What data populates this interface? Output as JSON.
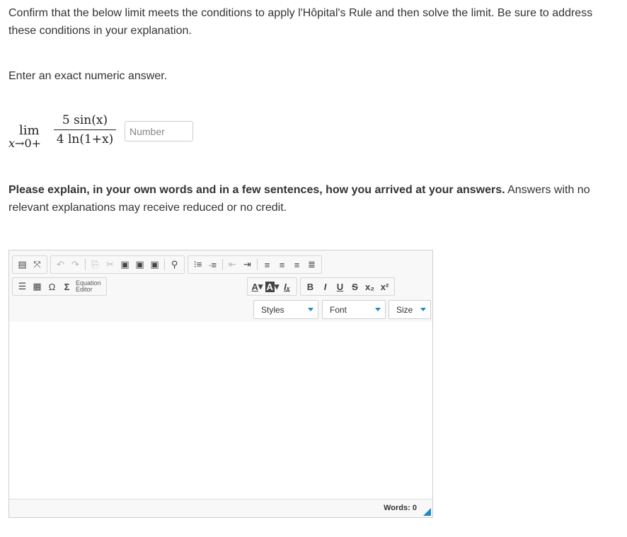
{
  "question": {
    "instructions": "Confirm that the below limit meets the conditions to apply l'Hôpital's Rule and then solve the limit. Be sure to address these conditions in your explanation.",
    "answer_prompt": "Enter an exact numeric answer.",
    "limit": {
      "operator": "lim",
      "variable": "x",
      "approach": "→0+",
      "numerator": "5 sin(x)",
      "denominator": "4 ln(1+x)"
    },
    "answer_input": {
      "placeholder": "Number",
      "value": ""
    },
    "explain_bold": "Please explain, in your own words and in a few sentences, how you arrived at your answers.",
    "explain_rest": " Answers with no relevant explanations may receive reduced or no credit."
  },
  "editor": {
    "toolbar_row1": [
      {
        "name": "source-icon",
        "glyph": "▤"
      },
      {
        "name": "maximize-icon",
        "glyph": "⤧"
      },
      {
        "name": "undo-icon",
        "glyph": "↶"
      },
      {
        "name": "redo-icon",
        "glyph": "↷"
      },
      {
        "name": "copy-icon",
        "glyph": "⎘"
      },
      {
        "name": "cut-icon",
        "glyph": "✂"
      },
      {
        "name": "paste-icon",
        "glyph": "📋"
      },
      {
        "name": "paste-text-icon",
        "glyph": "📄"
      },
      {
        "name": "paste-word-icon",
        "glyph": "📃"
      },
      {
        "name": "find-icon",
        "glyph": "🔍"
      },
      {
        "name": "numbered-list-icon",
        "glyph": "≔"
      },
      {
        "name": "bulleted-list-icon",
        "glyph": "☰"
      },
      {
        "name": "outdent-icon",
        "glyph": "⇤"
      },
      {
        "name": "indent-icon",
        "glyph": "⇥"
      },
      {
        "name": "align-left-icon",
        "glyph": "≡"
      },
      {
        "name": "align-center-icon",
        "glyph": "≡"
      },
      {
        "name": "align-right-icon",
        "glyph": "≡"
      },
      {
        "name": "justify-icon",
        "glyph": "≡"
      }
    ],
    "equation_editor_label": "Equation Editor",
    "format_buttons": {
      "bold": "B",
      "italic": "I",
      "underline": "U",
      "strike": "S",
      "subscript": "x₂",
      "superscript": "x²",
      "text_color": "A",
      "bg_color": "A",
      "remove_format": "Iₓ"
    },
    "styles_label": "Styles",
    "font_label": "Font",
    "size_label": "Size",
    "word_count_label": "Words:",
    "word_count": "0",
    "accent_color": "#1d8ac7"
  }
}
